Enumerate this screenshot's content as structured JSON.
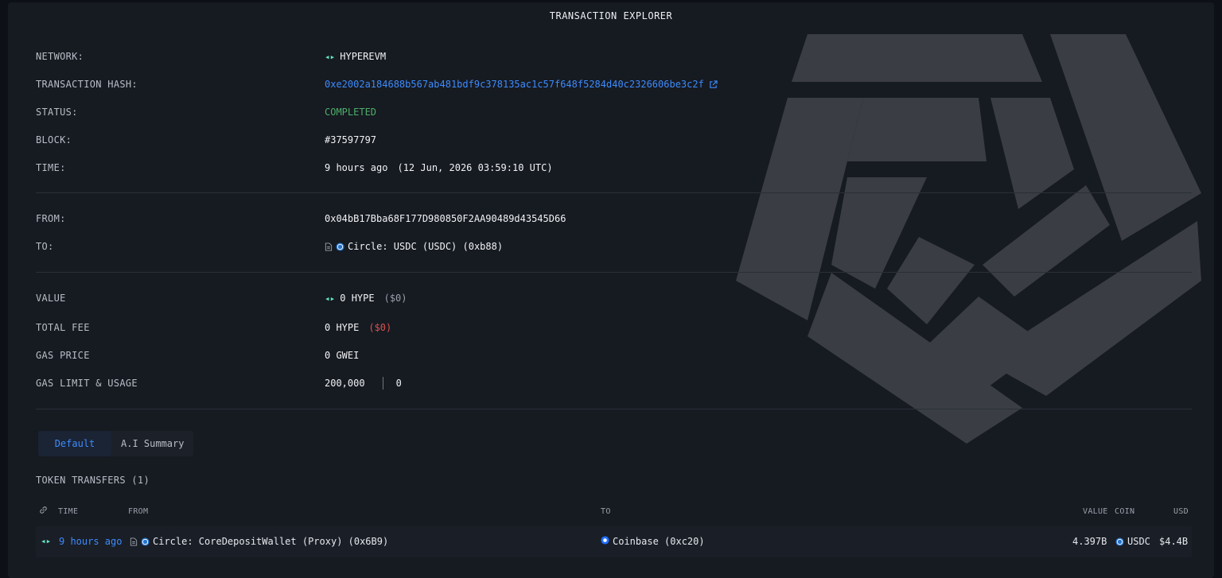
{
  "title": "TRANSACTION EXPLORER",
  "details": {
    "network": {
      "label": "NETWORK:",
      "value": "HYPEREVM"
    },
    "hash": {
      "label": "TRANSACTION HASH:",
      "value": "0xe2002a184688b567ab481bdf9c378135ac1c57f648f5284d40c2326606be3c2f"
    },
    "status": {
      "label": "STATUS:",
      "value": "COMPLETED"
    },
    "block": {
      "label": "BLOCK:",
      "value": "#37597797"
    },
    "time": {
      "label": "TIME:",
      "relative": "9 hours ago",
      "absolute": "(12 Jun, 2026 03:59:10 UTC)"
    },
    "from": {
      "label": "FROM:",
      "value": "0x04bB17Bba68F177D980850F2AA90489d43545D66"
    },
    "to": {
      "label": "TO:",
      "value": "Circle: USDC (USDC) (0xb88)"
    },
    "value": {
      "label": "VALUE",
      "amount": "0 HYPE",
      "usd": "($0)"
    },
    "fee": {
      "label": "TOTAL FEE",
      "amount": "0 HYPE",
      "usd": "($0)"
    },
    "gas_price": {
      "label": "GAS PRICE",
      "value": "0 GWEI"
    },
    "gas_limit": {
      "label": "GAS LIMIT & USAGE",
      "limit": "200,000",
      "usage": "0"
    }
  },
  "tabs": [
    {
      "label": "Default",
      "active": true
    },
    {
      "label": "A.I Summary",
      "active": false
    }
  ],
  "transfers": {
    "title": "TOKEN TRANSFERS (1)",
    "headers": {
      "time": "TIME",
      "from": "FROM",
      "to": "TO",
      "value": "VALUE",
      "coin": "COIN",
      "usd": "USD"
    },
    "rows": [
      {
        "time": "9 hours ago",
        "from": "Circle: CoreDepositWallet (Proxy) (0x6B9)",
        "to": "Coinbase (0xc20)",
        "value": "4.397B",
        "coin": "USDC",
        "usd": "$4.4B"
      }
    ]
  },
  "colors": {
    "accent": "#3d8bfd",
    "success": "#4caf6a",
    "danger": "#d9534f",
    "hype": "#5fe6c4",
    "background": "#161a21"
  },
  "icons": [
    "hyperevm-icon",
    "external-link-icon",
    "contract-doc-icon",
    "usdc-icon",
    "link-icon",
    "coinbase-icon",
    "watermark-logo"
  ]
}
